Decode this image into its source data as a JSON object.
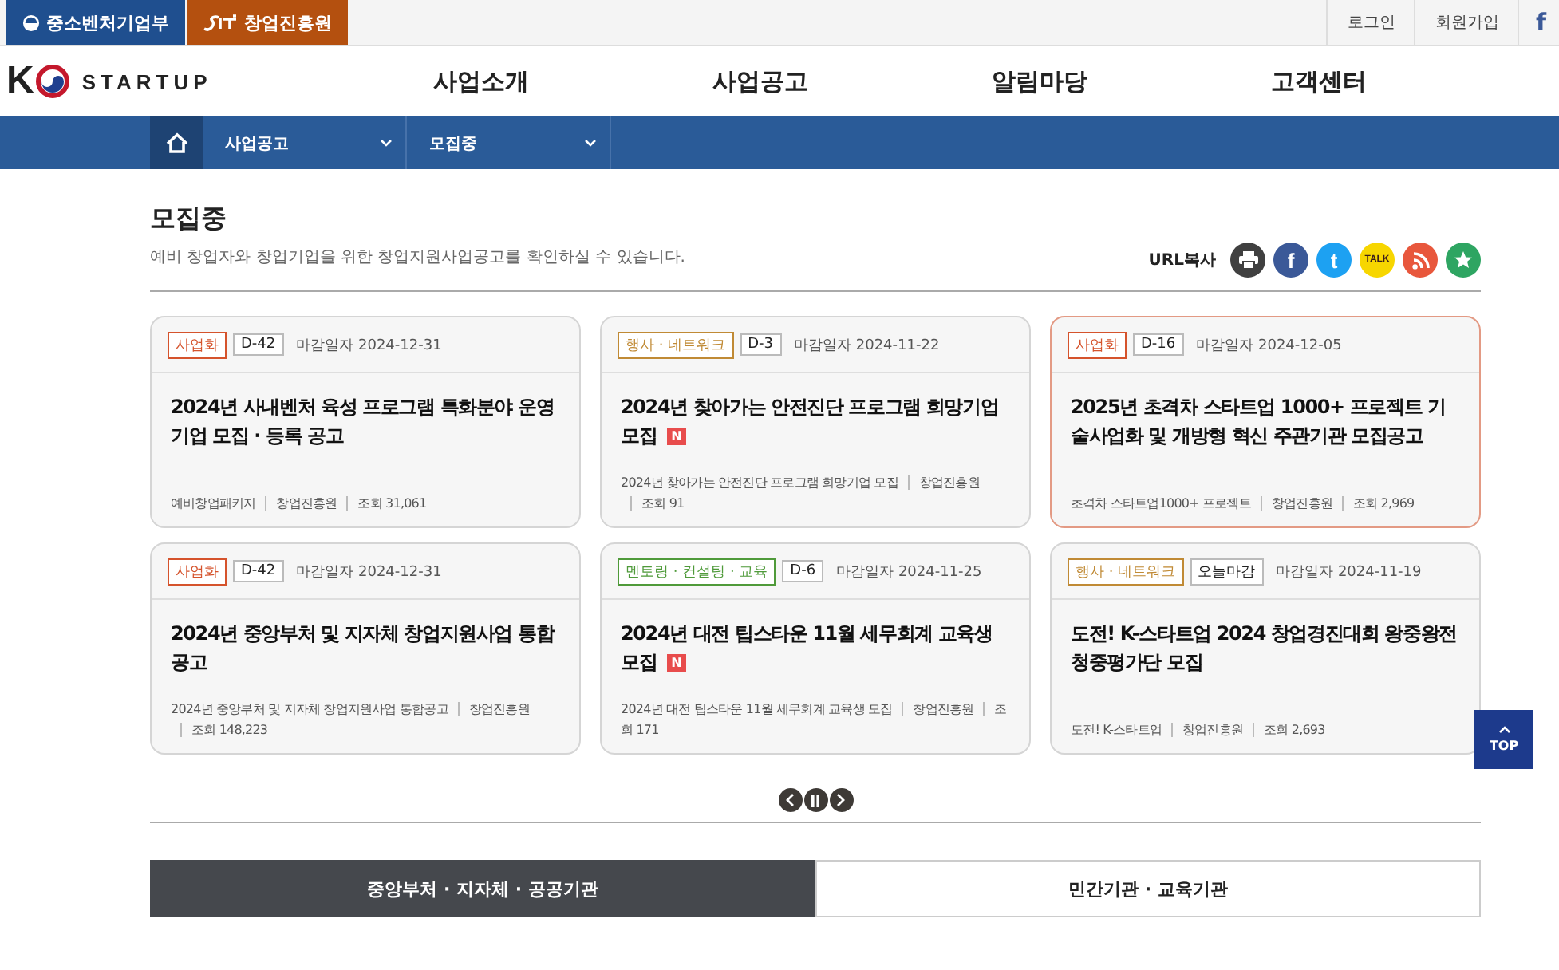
{
  "top_bar": {
    "brands": [
      {
        "kind": "ministry",
        "label": "중소벤처기업부",
        "color": "#1f4f8f"
      },
      {
        "kind": "agency",
        "label": "창업진흥원",
        "color": "#b4500f"
      }
    ],
    "links": [
      "로그인",
      "회원가입"
    ],
    "facebook_glyph": "f"
  },
  "header": {
    "logo": {
      "letter": "K",
      "word": "STARTUP"
    },
    "nav": [
      "사업소개",
      "사업공고",
      "알림마당",
      "고객센터"
    ]
  },
  "breadcrumb": [
    "사업공고",
    "모집중"
  ],
  "page": {
    "title": "모집중",
    "description": "예비 창업자와 창업기업을 위한 창업지원사업공고를 확인하실 수 있습니다.",
    "share_label": "URL복사",
    "share": [
      {
        "kind": "print",
        "color": "#404040"
      },
      {
        "kind": "facebook",
        "glyph": "f",
        "color": "#3b5998"
      },
      {
        "kind": "twitter",
        "glyph": "t",
        "color": "#1da1f2"
      },
      {
        "kind": "kakao",
        "glyph": "TALK",
        "color": "#f7d600"
      },
      {
        "kind": "rss",
        "color": "#e8573c"
      },
      {
        "kind": "bookmark",
        "color": "#2ea562"
      }
    ]
  },
  "cards": [
    {
      "category": "사업화",
      "color": "#d5532c",
      "dday": "D-42",
      "deadline": "마감일자 2024-12-31",
      "title": "2024년 사내벤처 육성 프로그램 특화분야 운영기업 모집 · 등록 공고",
      "highlighted": false,
      "meta": [
        "예비창업패키지",
        "창업진흥원",
        "조회 31,061"
      ]
    },
    {
      "category": "행사 · 네트워크",
      "color": "#c08a35",
      "dday": "D-3",
      "deadline": "마감일자 2024-11-22",
      "title": "2024년 찾아가는 안전진단 프로그램 희망기업 모집",
      "new_mark": "N",
      "highlighted": false,
      "meta": [
        "2024년 찾아가는 안전진단 프로그램 희망기업 모집",
        "창업진흥원",
        "조회 91"
      ]
    },
    {
      "category": "사업화",
      "color": "#d5532c",
      "dday": "D-16",
      "deadline": "마감일자 2024-12-05",
      "title": "2025년 초격차 스타트업 1000+ 프로젝트 기술사업화 및 개방형 혁신 주관기관 모집공고",
      "highlighted": true,
      "meta": [
        "초격차 스타트업1000+ 프로젝트",
        "창업진흥원",
        "조회 2,969"
      ]
    },
    {
      "category": "사업화",
      "color": "#d5532c",
      "dday": "D-42",
      "deadline": "마감일자 2024-12-31",
      "title": "2024년 중앙부처 및 지자체 창업지원사업 통합공고",
      "highlighted": false,
      "meta": [
        "2024년 중앙부처 및 지자체 창업지원사업 통합공고",
        "창업진흥원",
        "조회 148,223"
      ]
    },
    {
      "category": "멘토링 · 컨설팅 · 교육",
      "color": "#4f9a3a",
      "dday": "D-6",
      "deadline": "마감일자 2024-11-25",
      "title": "2024년 대전 팁스타운 11월 세무회계 교육생 모집",
      "new_mark": "N",
      "highlighted": false,
      "meta": [
        "2024년 대전 팁스타운 11월 세무회계 교육생 모집",
        "창업진흥원",
        "조회 171"
      ]
    },
    {
      "category": "행사 · 네트워크",
      "color": "#c08a35",
      "dday": "오늘마감",
      "deadline": "마감일자 2024-11-19",
      "title": "도전! K-스타트업 2024 창업경진대회 왕중왕전 청중평가단 모집",
      "highlighted": false,
      "meta": [
        "도전! K-스타트업",
        "창업진흥원",
        "조회 2,693"
      ]
    }
  ],
  "tabs": [
    {
      "label": "중앙부처 · 지자체 · 공공기관",
      "selected": true
    },
    {
      "label": "민간기관 · 교육기관",
      "selected": false
    }
  ],
  "top_button": {
    "label": "TOP"
  }
}
